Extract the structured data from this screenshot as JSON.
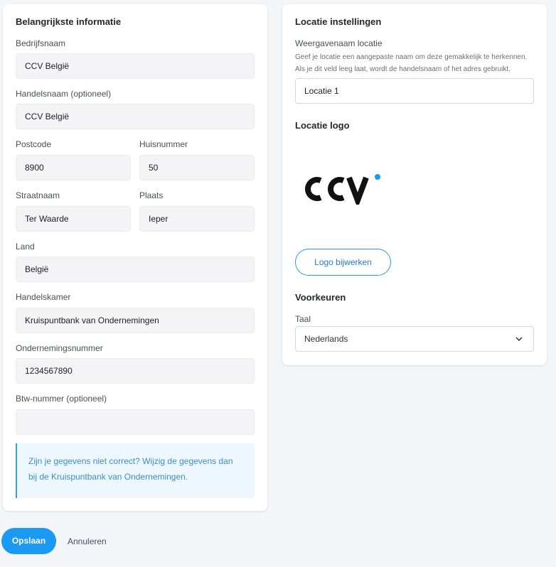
{
  "left_card": {
    "title": "Belangrijkste informatie",
    "company_name": {
      "label": "Bedrijfsnaam",
      "value": "CCV België"
    },
    "trade_name": {
      "label": "Handelsnaam (optioneel)",
      "value": "CCV België"
    },
    "postcode": {
      "label": "Postcode",
      "value": "8900"
    },
    "house_number": {
      "label": "Huisnummer",
      "value": "50"
    },
    "street": {
      "label": "Straatnaam",
      "value": "Ter Waarde"
    },
    "city": {
      "label": "Plaats",
      "value": "Ieper"
    },
    "country": {
      "label": "Land",
      "value": "België"
    },
    "chamber": {
      "label": "Handelskamer",
      "value": "Kruispuntbank van Ondernemingen"
    },
    "company_number": {
      "label": "Ondernemingsnummer",
      "value": "1234567890"
    },
    "vat_number": {
      "label": "Btw-nummer (optioneel)",
      "value": ""
    },
    "info_text": "Zijn je gegevens niet correct? Wijzig de gegevens dan bij de Kruispuntbank van Ondernemingen."
  },
  "right_card": {
    "title": "Locatie instellingen",
    "display_name": {
      "label": "Weergavenaam locatie",
      "helper": "Geef je locatie een aangepaste naam om deze gemakkelijk te herkennen. Als je dit veld leeg laat, wordt de handelsnaam of het adres gebruikt.",
      "value": "Locatie 1"
    },
    "logo_title": "Locatie logo",
    "logo_text": "CCV",
    "logo_button": "Logo bijwerken",
    "preferences_title": "Voorkeuren",
    "language": {
      "label": "Taal",
      "value": "Nederlands"
    }
  },
  "actions": {
    "save": "Opslaan",
    "cancel": "Annuleren"
  },
  "colors": {
    "primary": "#1a9af2",
    "info_text": "#3b8ec8",
    "logo_dot": "#1a9af2"
  }
}
